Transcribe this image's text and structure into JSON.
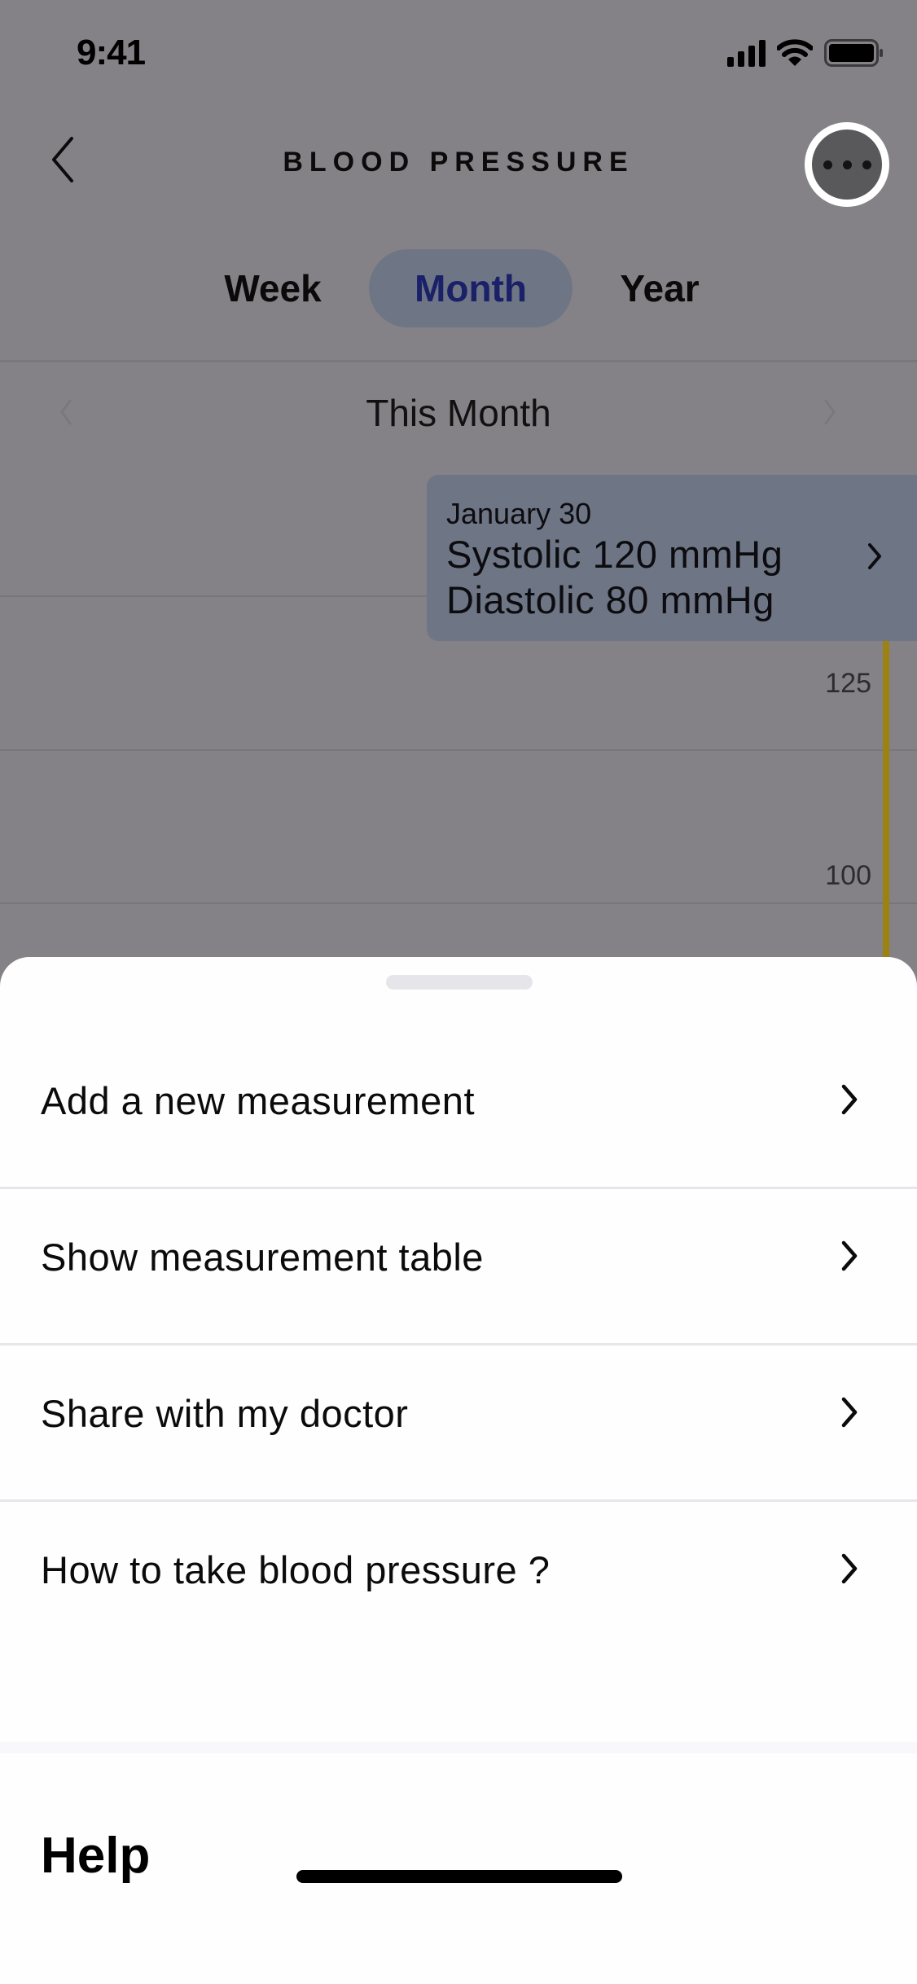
{
  "status_bar": {
    "time": "9:41",
    "icons": [
      "cellular-signal-icon",
      "wifi-icon",
      "battery-icon"
    ]
  },
  "nav": {
    "title": "BLOOD PRESSURE",
    "back_icon": "chevron-left-icon",
    "more_icon": "more-horizontal-icon"
  },
  "segments": {
    "items": [
      {
        "label": "Week",
        "selected": false
      },
      {
        "label": "Month",
        "selected": true
      },
      {
        "label": "Year",
        "selected": false
      }
    ],
    "selected_color": "#1b2168"
  },
  "period": {
    "label": "This Month",
    "prev_icon": "chevron-left-icon",
    "next_icon": "chevron-right-icon"
  },
  "chart": {
    "y_ticks": [
      "125",
      "100"
    ],
    "tooltip": {
      "date": "January 30",
      "systolic": "Systolic 120 mmHg",
      "diastolic": "Diastolic 80 mmHg"
    },
    "accent_color": "#a38a0c"
  },
  "chart_data": {
    "type": "bar",
    "title": "Blood Pressure — This Month",
    "categories": [
      "January 30"
    ],
    "series": [
      {
        "name": "Systolic",
        "values": [
          120
        ],
        "unit": "mmHg"
      },
      {
        "name": "Diastolic",
        "values": [
          80
        ],
        "unit": "mmHg"
      }
    ],
    "y_ticks": [
      125,
      100
    ],
    "ylabel": "mmHg",
    "grid": true
  },
  "sheet": {
    "items": [
      {
        "label": "Add a new measurement"
      },
      {
        "label": "Show measurement table"
      },
      {
        "label": "Share with my doctor"
      },
      {
        "label": "How to take blood pressure ?"
      }
    ],
    "help_title": "Help"
  }
}
